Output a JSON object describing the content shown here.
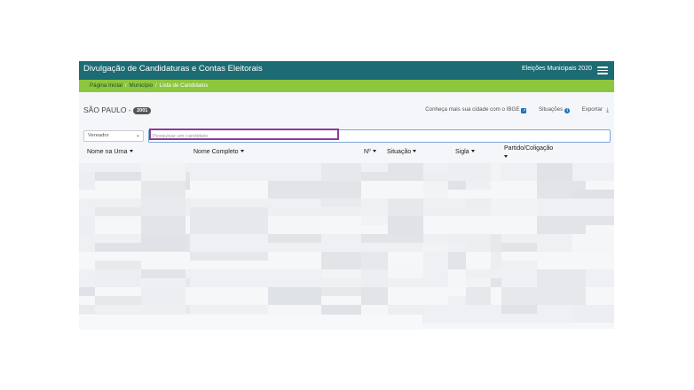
{
  "header": {
    "title": "Divulgação de Candidaturas e Contas Eleitorais",
    "election": "Eleições Municipais 2020"
  },
  "breadcrumb": {
    "items": [
      "Página Inicial",
      "Município",
      "Lista de Candidatos"
    ]
  },
  "city": {
    "name": "SÃO PAULO -",
    "year_badge": "2001"
  },
  "links": {
    "ibge": "Conheça mais sua cidade com o IBGE",
    "situacoes": "Situações",
    "exportar": "Exportar"
  },
  "filter": {
    "role_selected": "Vereador",
    "search_placeholder": "Pesquisar um candidato"
  },
  "table": {
    "columns": [
      "Nome na Urna",
      "Nome Completo",
      "Nº",
      "Situação",
      "Sigla",
      "Partido/Coligação"
    ]
  },
  "colors": {
    "header_bg": "#1d6b73",
    "breadcrumb_bg": "#8dc63f",
    "highlight_border": "#8e3b9b",
    "search_border": "#7aa7d8"
  }
}
